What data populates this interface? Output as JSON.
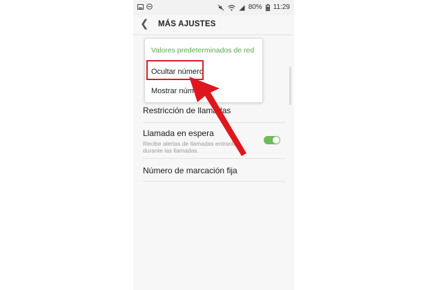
{
  "status_bar": {
    "left_icons": [
      "image-icon",
      "dnd-icon"
    ],
    "right_icons": [
      "mute-icon",
      "wifi-icon",
      "signal-icon"
    ],
    "battery": "80%",
    "time": "11:29"
  },
  "header": {
    "back_icon": "back-chevron-icon",
    "title": "MÁS AJUSTES"
  },
  "popup": {
    "header": "Valores predeterminados de red",
    "options": [
      "Ocultar número",
      "Mostrar núme"
    ]
  },
  "settings": {
    "call_restriction": "Restricción de llamadas",
    "call_waiting": {
      "title": "Llamada en espera",
      "subtitle": "Recibe alertas de llamadas entrantes durante las llamadas.",
      "enabled": true
    },
    "fixed_dialing": "Número de marcación fija"
  },
  "annotations": {
    "highlight_color": "#d21f25",
    "arrow_color": "#e0161e"
  }
}
